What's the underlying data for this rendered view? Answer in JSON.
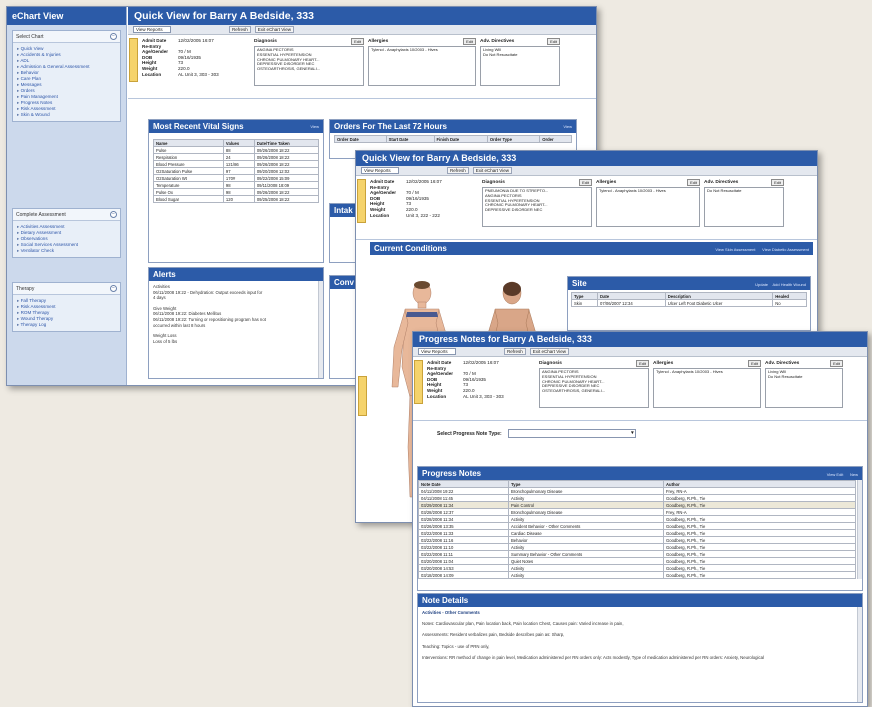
{
  "w1": {
    "sidebar_title": "eChart View",
    "panels": [
      {
        "title": "Select Chart",
        "items": [
          "Quick View",
          "Accidents & Injuries",
          "ADL",
          "Admission & General Assessment",
          "Behavior",
          "Care Plan",
          "Messages",
          "Orders",
          "Pain Management",
          "Progress Notes",
          "Risk Assessment",
          "Skin & Wound"
        ]
      },
      {
        "title": "Complete Assessment",
        "items": [
          "Activities Assessment",
          "Dietary Assessment",
          "Observations",
          "Social Services Assessment",
          "Ventilator Check"
        ]
      },
      {
        "title": "Therapy",
        "items": [
          "Fall Therapy",
          "Risk Assessment",
          "ROM Therapy",
          "Wound Therapy",
          "Therapy Log"
        ]
      }
    ],
    "title": "Quick View for Barry A Bedside, 333",
    "toolbar": {
      "view_reports": "View Reports",
      "refresh": "Refresh",
      "exit": "Exit eChart View"
    },
    "sections": {
      "vitals": {
        "title": "Most Recent Vital Signs",
        "link": "View",
        "headers": [
          "Name",
          "Values",
          "Date/Time Taken"
        ],
        "rows": [
          [
            "Pulse",
            "88",
            "09/26/2008 18:22"
          ],
          [
            "Respiration",
            "24",
            "09/26/2008 18:22"
          ],
          [
            "Blood Pressure",
            "121/86",
            "09/26/2008 18:22"
          ],
          [
            "O2Saturation Pulse",
            "97",
            "09/20/2008 12:02"
          ],
          [
            "O2Saturation Wt",
            "170#",
            "09/22/2008 15:09"
          ],
          [
            "Temperature",
            "98",
            "09/11/2008 18:09"
          ],
          [
            "Pulse Ox",
            "98",
            "09/26/2008 18:22"
          ],
          [
            "Blood Sugar",
            "120",
            "09/25/2008 18:22"
          ]
        ]
      },
      "orders": {
        "title": "Orders For The Last 72 Hours",
        "link": "View",
        "headers": [
          "Order Date",
          "Start Date",
          "Finish Date",
          "Order Type",
          "Order"
        ]
      },
      "alerts": {
        "title": "Alerts",
        "lines": [
          "Activities",
          "06/11/2008 19:22 - Dehydration: Output exceeds input for",
          "4 days",
          "",
          "Give Weight",
          "06/11/2008 19:22: Diabetes Mellitus",
          "06/11/2008 19:22: Turning or repositioning program has not",
          "occurred within last 8 hours",
          "",
          "Weight Loss",
          "Loss of 5 lbs"
        ]
      },
      "intake": {
        "title": "Intak"
      },
      "cond": {
        "title": "Conv"
      }
    }
  },
  "patient": {
    "labels": [
      "Admit Date",
      "Re-Entry",
      "Age/Gender",
      "DOB",
      "Height",
      "Weight",
      "Location"
    ],
    "values": [
      "12/02/2005 16:07",
      "",
      "70 / M",
      "09/16/1935",
      "73",
      "220.0",
      "AL Unit 3, 303 - 303"
    ],
    "diagnosis": {
      "label": "Diagnosis",
      "edit": "Edit",
      "items": [
        "ANGINA PECTORIS",
        "ESSENTIAL HYPERTENSION",
        "CHRONIC PULMONARY HEART...",
        "DEPRESSIVE DISORDER NEC",
        "OSTEOARTHROSIS, GENERALI..."
      ]
    },
    "allergies": {
      "label": "Allergies",
      "edit": "Edit",
      "items": [
        "Tylenol - Anaphylaxis 10/2003 - Hives"
      ]
    },
    "adv": {
      "label": "Adv. Directives",
      "edit": "Edit",
      "items": [
        "Living Will",
        "Do Not Resuscitate"
      ]
    }
  },
  "w2": {
    "title": "Quick View for Barry A Bedside, 333",
    "diag_first": "PNEUMONIA DUE TO STREPTO...",
    "location": "Unit 3, 222 - 222",
    "conditions": {
      "title": "Current Conditions",
      "links": [
        "View Skin Assessment",
        "View Diabetic Assessment"
      ]
    },
    "site": {
      "title": "Site",
      "links": [
        "Update",
        "Add Health Wound"
      ],
      "headers": [
        "Type",
        "Date",
        "Description",
        "Healed"
      ],
      "row": [
        "Skin",
        "07/06/2007 12:34",
        "Ulcer Left Foot Diabetic Ulcer",
        "No"
      ]
    }
  },
  "w3": {
    "title": "Progress Notes for Barry A Bedside, 333",
    "select_label": "Select Progress Note Type:",
    "notes": {
      "title": "Progress Notes",
      "links": [
        "View Edit",
        "New"
      ],
      "headers": [
        "Note Date",
        "Type",
        "Author"
      ],
      "rows": [
        [
          "04/11/2008 19:22",
          "Bronchopulmonary Disease",
          "Frey, RN-A"
        ],
        [
          "04/11/2008 11:45",
          "Activity",
          "Goodberg, R.Ph., Tie"
        ],
        [
          "03/29/2008 11:34",
          "Pain Control",
          "Goodberg, R.Ph., Tie"
        ],
        [
          "03/28/2008 12:37",
          "Bronchopulmonary Disease",
          "Frey, RN-A"
        ],
        [
          "03/28/2008 11:34",
          "Activity",
          "Goodberg, R.Ph., Tie"
        ],
        [
          "03/26/2008 13:35",
          "Accident Behavior - Other Comments",
          "Goodberg, R.Ph., Tie"
        ],
        [
          "03/22/2008 11:33",
          "Cardiac Disease",
          "Goodberg, R.Ph., Tie"
        ],
        [
          "03/22/2008 11:16",
          "Behavior",
          "Goodberg, R.Ph., Tie"
        ],
        [
          "03/22/2008 11:10",
          "Activity",
          "Goodberg, R.Ph., Tie"
        ],
        [
          "03/22/2008 11:11",
          "Summary Behavior - Other Comments",
          "Goodberg, R.Ph., Tie"
        ],
        [
          "03/20/2008 11:04",
          "Quiet Notes",
          "Goodberg, R.Ph., Tie"
        ],
        [
          "03/20/2008 14:53",
          "Activity",
          "Goodberg, R.Ph., Tie"
        ],
        [
          "03/18/2008 14:09",
          "Activity",
          "Goodberg, R.Ph., Tie"
        ]
      ]
    },
    "details": {
      "title": "Note Details",
      "heading": "Activities - Other Comments",
      "paras": [
        "Notes: Cardiovascular plan, Pain location back, Pain location Chest, Causes pain: Varied increase in pain,",
        "Assessments: Resident verbalizes pain, Bedside describes pain as: Sharp,",
        "Teaching: Topics - use of PRN only,",
        "Interventions: RR method of change in pain level, Medication administered per RN orders only: Acts modestly, Type of medication administered per RN orders: Anxiety, Neurological"
      ]
    }
  },
  "colors": {
    "title_bar": "#2c5ba8",
    "sidebar": "#ccd9ec",
    "tab_yellow": "#f5d36b"
  }
}
